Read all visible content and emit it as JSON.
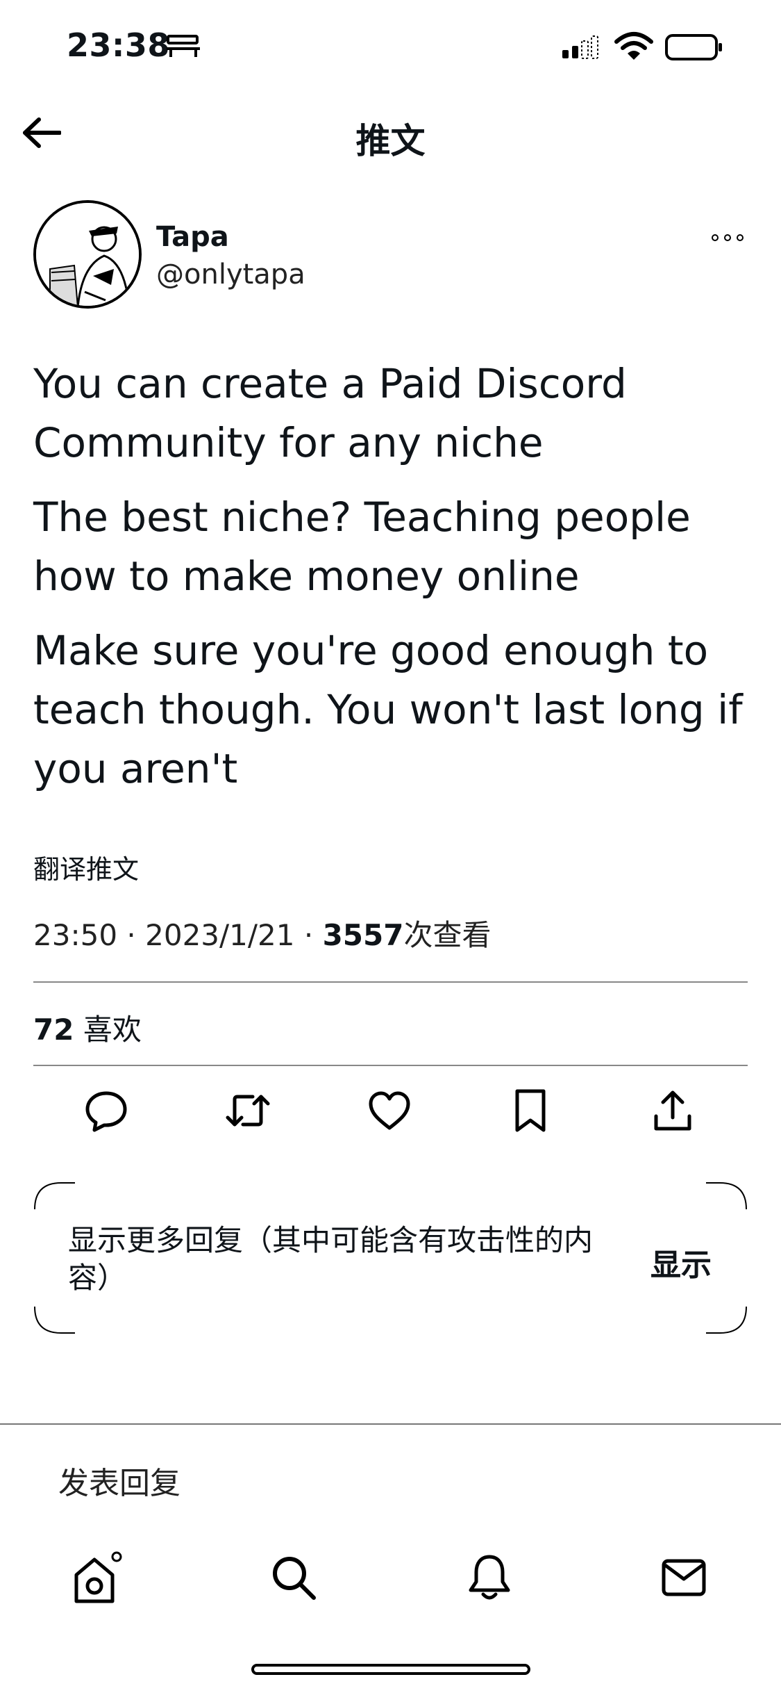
{
  "status_bar": {
    "time": "23:38",
    "icons": [
      "sim-card-icon",
      "cellular-signal-icon",
      "wifi-icon",
      "battery-icon"
    ]
  },
  "header": {
    "title": "推文",
    "back_icon": "arrow-left-icon"
  },
  "author": {
    "name": "Tapa",
    "handle": "@onlytapa",
    "more_icon": "ellipsis-icon"
  },
  "tweet": {
    "paragraphs": [
      "You can create a Paid Discord Community for any niche",
      "The best niche? Teaching people how to make money online",
      "Make sure you're good enough to teach though. You won't last long if you aren't"
    ],
    "translate_label": "翻译推文",
    "time": "23:50",
    "date": "2023/1/21",
    "views_count": "3557",
    "views_label": "次查看",
    "separator": "·"
  },
  "stats": {
    "likes_count": "72",
    "likes_label": "喜欢"
  },
  "actions": [
    {
      "name": "reply",
      "icon": "comment-icon"
    },
    {
      "name": "retweet",
      "icon": "retweet-icon"
    },
    {
      "name": "like",
      "icon": "heart-icon"
    },
    {
      "name": "bookmark",
      "icon": "bookmark-icon"
    },
    {
      "name": "share",
      "icon": "share-icon"
    }
  ],
  "notice": {
    "text": "显示更多回复（其中可能含有攻击性的内容）",
    "button_label": "显示"
  },
  "composer": {
    "placeholder": "发表回复"
  },
  "bottom_nav": [
    {
      "name": "home",
      "icon": "home-icon"
    },
    {
      "name": "search",
      "icon": "search-icon"
    },
    {
      "name": "notifications",
      "icon": "bell-icon"
    },
    {
      "name": "messages",
      "icon": "mail-icon"
    }
  ]
}
